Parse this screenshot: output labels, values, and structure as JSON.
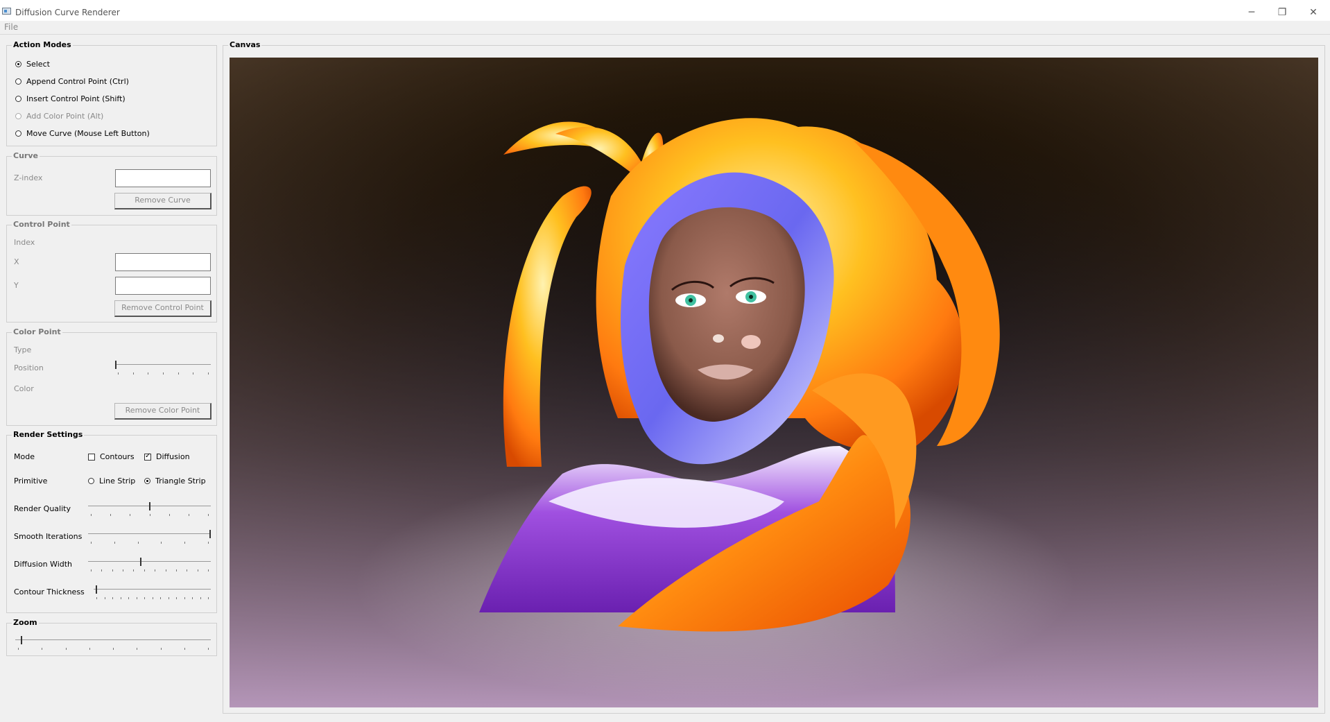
{
  "window": {
    "title": "Diffusion Curve Renderer",
    "minimize_glyph": "─",
    "maximize_glyph": "❐",
    "close_glyph": "✕"
  },
  "menu": {
    "file": "File"
  },
  "action_modes": {
    "title": "Action Modes",
    "items": [
      {
        "label": "Select",
        "checked": true,
        "enabled": true
      },
      {
        "label": "Append Control Point (Ctrl)",
        "checked": false,
        "enabled": true
      },
      {
        "label": "Insert Control Point (Shift)",
        "checked": false,
        "enabled": true
      },
      {
        "label": "Add Color Point (Alt)",
        "checked": false,
        "enabled": false
      },
      {
        "label": "Move Curve (Mouse Left Button)",
        "checked": false,
        "enabled": true
      }
    ]
  },
  "curve": {
    "title": "Curve",
    "zindex_label": "Z-index",
    "zindex_value": "",
    "remove_label": "Remove Curve"
  },
  "control_point": {
    "title": "Control Point",
    "index_label": "Index",
    "x_label": "X",
    "x_value": "",
    "y_label": "Y",
    "y_value": "",
    "remove_label": "Remove Control Point"
  },
  "color_point": {
    "title": "Color Point",
    "type_label": "Type",
    "position_label": "Position",
    "position_value": 0.0,
    "color_label": "Color",
    "remove_label": "Remove Color Point"
  },
  "render_settings": {
    "title": "Render Settings",
    "mode_label": "Mode",
    "contours_label": "Contours",
    "contours_checked": false,
    "diffusion_label": "Diffusion",
    "diffusion_checked": true,
    "primitive_label": "Primitive",
    "line_strip_label": "Line Strip",
    "line_strip_checked": false,
    "triangle_strip_label": "Triangle Strip",
    "triangle_strip_checked": true,
    "render_quality_label": "Render Quality",
    "render_quality_value": 0.5,
    "smooth_iterations_label": "Smooth Iterations",
    "smooth_iterations_value": 1.0,
    "diffusion_width_label": "Diffusion Width",
    "diffusion_width_value": 0.43,
    "contour_thickness_label": "Contour Thickness",
    "contour_thickness_value": 0.02
  },
  "zoom": {
    "title": "Zoom",
    "value": 0.03
  },
  "canvas": {
    "title": "Canvas"
  }
}
